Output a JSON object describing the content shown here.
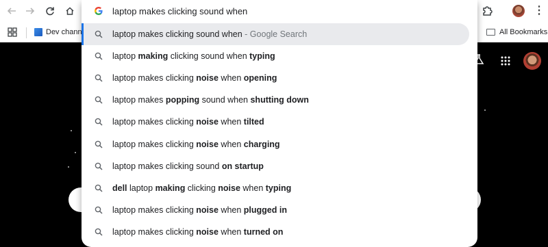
{
  "browser": {
    "bookmarks_bar": {
      "items": [
        {
          "label": "Dev channel"
        }
      ],
      "all_bookmarks_label": "All Bookmarks"
    },
    "nav_icons": [
      "back-arrow-icon",
      "forward-arrow-icon",
      "reload-icon",
      "home-icon"
    ],
    "toolbar_icons": [
      "extensions-icon",
      "profile-avatar-icon",
      "more-menu-icon"
    ]
  },
  "omnibox": {
    "query": "laptop makes clicking sound when"
  },
  "suggestions": [
    {
      "parts": [
        {
          "t": "laptop makes clicking sound when",
          "b": false
        }
      ],
      "suffix": " - Google Search",
      "active": true
    },
    {
      "parts": [
        {
          "t": "laptop ",
          "b": false
        },
        {
          "t": "making",
          "b": true
        },
        {
          "t": " clicking sound when ",
          "b": false
        },
        {
          "t": "typing",
          "b": true
        }
      ]
    },
    {
      "parts": [
        {
          "t": "laptop makes clicking ",
          "b": false
        },
        {
          "t": "noise",
          "b": true
        },
        {
          "t": " when ",
          "b": false
        },
        {
          "t": "opening",
          "b": true
        }
      ]
    },
    {
      "parts": [
        {
          "t": "laptop makes ",
          "b": false
        },
        {
          "t": "popping",
          "b": true
        },
        {
          "t": " sound when ",
          "b": false
        },
        {
          "t": "shutting down",
          "b": true
        }
      ]
    },
    {
      "parts": [
        {
          "t": "laptop makes clicking ",
          "b": false
        },
        {
          "t": "noise",
          "b": true
        },
        {
          "t": " when ",
          "b": false
        },
        {
          "t": "tilted",
          "b": true
        }
      ]
    },
    {
      "parts": [
        {
          "t": "laptop makes clicking ",
          "b": false
        },
        {
          "t": "noise",
          "b": true
        },
        {
          "t": " when ",
          "b": false
        },
        {
          "t": "charging",
          "b": true
        }
      ]
    },
    {
      "parts": [
        {
          "t": "laptop makes clicking sound ",
          "b": false
        },
        {
          "t": "on startup",
          "b": true
        }
      ]
    },
    {
      "parts": [
        {
          "t": "dell",
          "b": true
        },
        {
          "t": " laptop ",
          "b": false
        },
        {
          "t": "making",
          "b": true
        },
        {
          "t": " clicking ",
          "b": false
        },
        {
          "t": "noise",
          "b": true
        },
        {
          "t": " when ",
          "b": false
        },
        {
          "t": "typing",
          "b": true
        }
      ]
    },
    {
      "parts": [
        {
          "t": "laptop makes clicking ",
          "b": false
        },
        {
          "t": "noise",
          "b": true
        },
        {
          "t": " when ",
          "b": false
        },
        {
          "t": "plugged in",
          "b": true
        }
      ]
    },
    {
      "parts": [
        {
          "t": "laptop makes clicking ",
          "b": false
        },
        {
          "t": "noise",
          "b": true
        },
        {
          "t": " when ",
          "b": false
        },
        {
          "t": "turned on",
          "b": true
        }
      ]
    }
  ],
  "page": {
    "header_icons": [
      "labs-flask-icon",
      "google-apps-icon",
      "account-avatar-icon"
    ]
  },
  "colors": {
    "page_background": "#000000",
    "accent": "#1a73e8",
    "active_row": "#e9eaed"
  }
}
